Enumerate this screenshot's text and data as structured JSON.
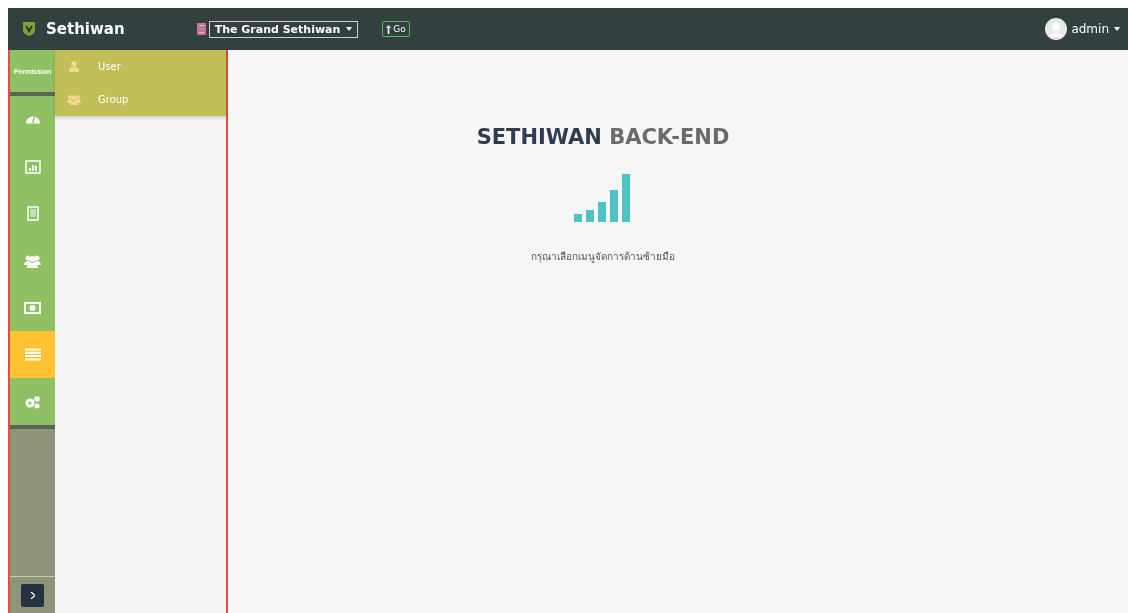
{
  "header": {
    "brand": "Sethiwan",
    "hotel_select": {
      "value": "The Grand Sethiwan"
    },
    "go_button": "Go",
    "user": "admin"
  },
  "sidebar": {
    "items": [
      {
        "label": "Permission",
        "selected": false
      },
      {
        "selected": false
      },
      {
        "selected": false
      },
      {
        "selected": false
      },
      {
        "selected": false
      },
      {
        "selected": false
      },
      {
        "selected": true
      },
      {
        "selected": false
      }
    ]
  },
  "submenu": {
    "items": [
      {
        "label": "User"
      },
      {
        "label": "Group"
      }
    ]
  },
  "main": {
    "title_dark": "SETHIWAN",
    "title_light": "BACK-END",
    "message": "กรุณาเลือกเมนูจัดการด้านซ้ายมือ"
  }
}
